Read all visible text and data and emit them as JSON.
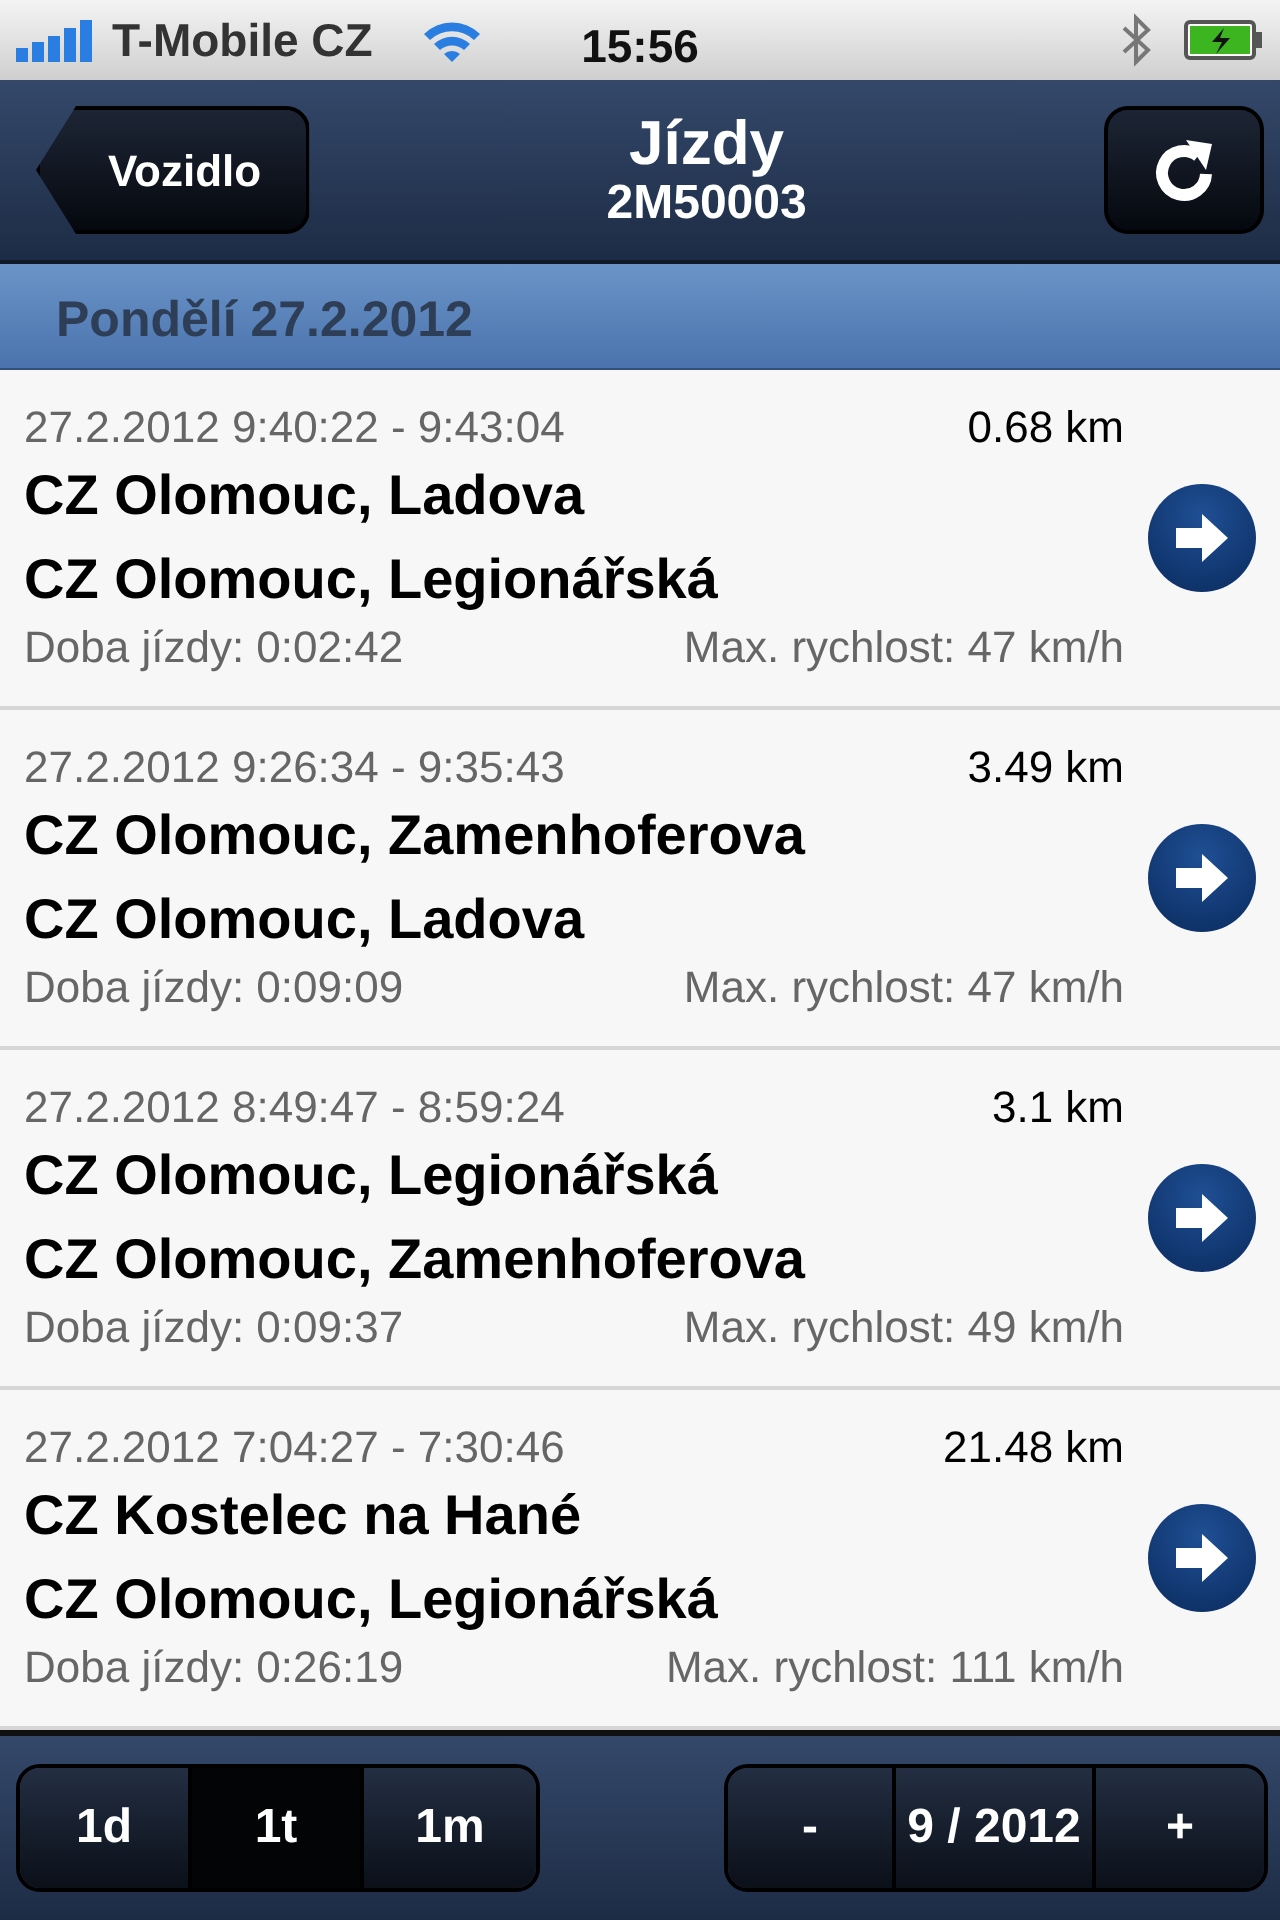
{
  "status_bar": {
    "carrier": "T-Mobile CZ",
    "time": "15:56"
  },
  "nav": {
    "back": "Vozidlo",
    "title": "Jízdy",
    "subtitle": "2M50003"
  },
  "section": "Pondělí 27.2.2012",
  "trips": [
    {
      "time": "27.2.2012 9:40:22 - 9:43:04",
      "distance": "0.68 km",
      "from": "CZ Olomouc, Ladova",
      "to": "CZ Olomouc, Legionářská",
      "duration": "Doba jízdy: 0:02:42",
      "max_speed": "Max. rychlost: 47 km/h"
    },
    {
      "time": "27.2.2012 9:26:34 - 9:35:43",
      "distance": "3.49 km",
      "from": "CZ Olomouc, Zamenhoferova",
      "to": "CZ Olomouc, Ladova",
      "duration": "Doba jízdy: 0:09:09",
      "max_speed": "Max. rychlost: 47 km/h"
    },
    {
      "time": "27.2.2012 8:49:47 - 8:59:24",
      "distance": "3.1 km",
      "from": "CZ Olomouc, Legionářská",
      "to": "CZ Olomouc, Zamenhoferova",
      "duration": "Doba jízdy: 0:09:37",
      "max_speed": "Max. rychlost: 49 km/h"
    },
    {
      "time": "27.2.2012 7:04:27 - 7:30:46",
      "distance": "21.48 km",
      "from": "CZ Kostelec na Hané",
      "to": "CZ Olomouc, Legionářská",
      "duration": "Doba jízdy: 0:26:19",
      "max_speed": "Max. rychlost: 111 km/h"
    }
  ],
  "periods": [
    {
      "label": "1d",
      "selected": false
    },
    {
      "label": "1t",
      "selected": true
    },
    {
      "label": "1m",
      "selected": false
    }
  ],
  "pager": {
    "prev": "-",
    "label": "9 / 2012",
    "next": "+"
  }
}
